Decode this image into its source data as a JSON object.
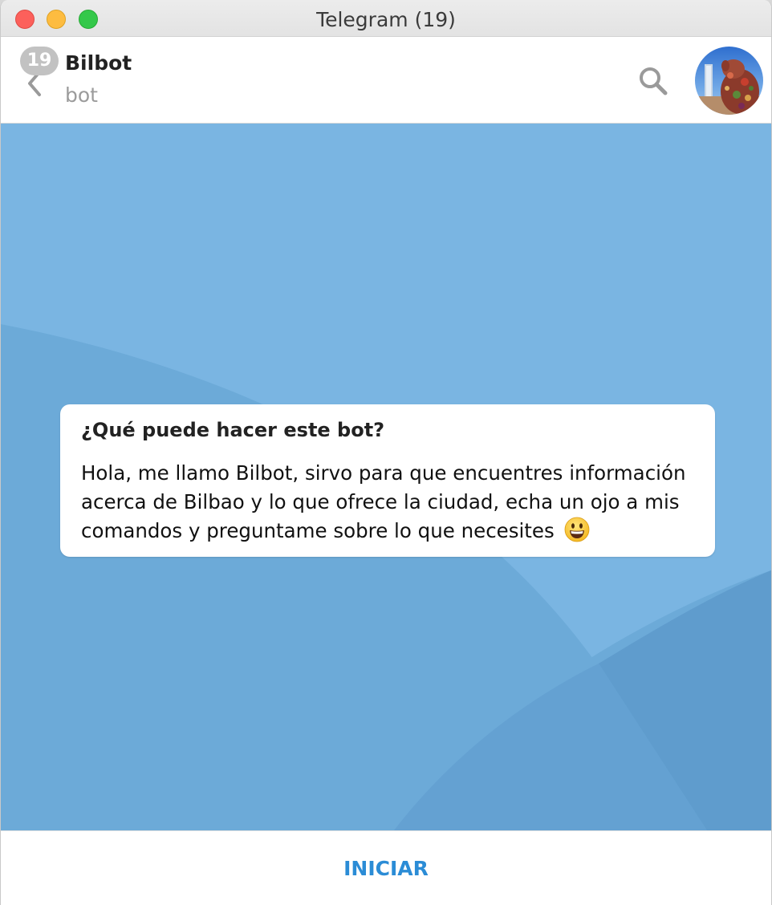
{
  "window": {
    "title": "Telegram (19)"
  },
  "header": {
    "unread_count": "19",
    "chat_name": "Bilbot",
    "chat_status": "bot"
  },
  "info_card": {
    "title": "¿Qué puede hacer este bot?",
    "body": "Hola, me llamo Bilbot, sirvo para que encuentres información acerca de Bilbao y lo que ofrece la ciudad, echa un ojo a mis comandos y preguntame sobre lo que necesites",
    "emoji": "smiling-face-emoji"
  },
  "bottom": {
    "start_label": "INICIAR"
  },
  "icons": {
    "back": "chevron-left-icon",
    "search": "search-icon"
  },
  "colors": {
    "chat_background": "#7ab5e2",
    "accent": "#2b8cd6",
    "badge": "#c2c2c2"
  }
}
